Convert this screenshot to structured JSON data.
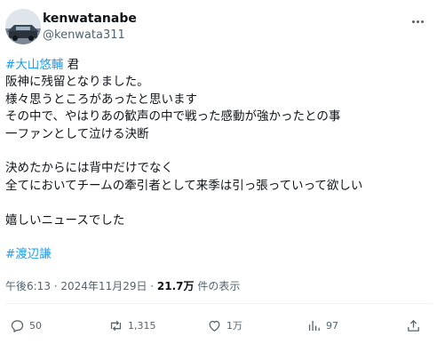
{
  "author": {
    "display_name": "kenwatanabe",
    "handle": "@kenwata311"
  },
  "tweet": {
    "hashtag_top": "#大山悠輔",
    "title_suffix": " 君",
    "lines": [
      "阪神に残留となりました。",
      "様々思うところがあったと思います",
      "その中で、やはりあの歓声の中で戦った感動が強かったとの事",
      "一ファンとして泣ける決断"
    ],
    "lines2": [
      "決めたからには背中だけでなく",
      "全てにおいてチームの牽引者として来季は引っ張っていって欲しい"
    ],
    "line3": "嬉しいニュースでした",
    "hashtag_bottom": "#渡辺謙"
  },
  "meta": {
    "time_date": "午後6:13 · 2024年11月29日 · ",
    "views": "21.7万",
    "views_suffix": " 件の表示"
  },
  "actions": {
    "replies": "50",
    "retweets": "1,315",
    "likes": "1万",
    "bookmarks": "97"
  },
  "colors": {
    "hashtag": "#1d9bf0",
    "secondary": "#536471",
    "primary": "#0f1419"
  },
  "icons": [
    "more-icon",
    "reply-icon",
    "retweet-icon",
    "like-icon",
    "views-icon",
    "share-icon"
  ]
}
